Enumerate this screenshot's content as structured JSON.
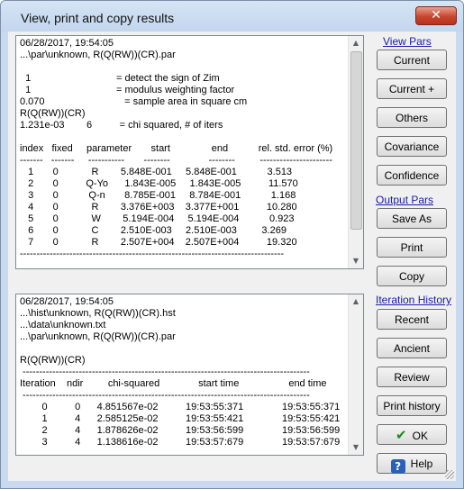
{
  "window": {
    "title": "View, print and copy results",
    "close_glyph": "✕"
  },
  "top_pane": {
    "lines": [
      "06/28/2017, 19:54:05",
      "...\\par\\unknown, R(Q(RW))(CR).par",
      "",
      "  1                               = detect the sign of Zim",
      "  1                               = modulus weighting factor",
      "0.070                             = sample area in square cm",
      "R(Q(RW))(CR)",
      "1.231e-03        6          = chi squared, # of iters",
      "",
      "index   fixed     parameter       start               end           rel. std. error (%)",
      "-------   -------     -----------       --------              --------         ----------------------",
      "   1       0            R        5.848E-001     5.848E-001           3.513",
      "   2       0          Q-Yo      1.843E-005     1.843E-005          11.570",
      "   3       0           Q-n       8.785E-001     8.784E-001           1.168",
      "   4       0            R        3.376E+003    3.377E+001          10.280",
      "   5       0            W        5.194E-004     5.194E-004           0.923",
      "   6       0            C        2.510E-003     2.510E-003         3.269",
      "   7       0            R        2.507E+004    2.507E+004          19.320",
      "--------------------------------------------------------------------------------"
    ]
  },
  "bottom_pane": {
    "lines": [
      "06/28/2017, 19:54:05",
      "...\\hist\\unknown, R(Q(RW))(CR).hst",
      "...\\data\\unknown.txt",
      "...\\par\\unknown, R(Q(RW))(CR).par",
      "",
      "R(Q(RW))(CR)",
      " ---------------------------------------------------------------------------------------",
      "Iteration    ndir         chi-squared              start time                  end time",
      " ---------------------------------------------------------------------------------------",
      "        0          0      4.851567e-02          19:53:55:371              19:53:55:371",
      "        1          4      2.585125e-02          19:53:55:421              19:53:55:421",
      "        2          4      1.878626e-02          19:53:56:599              19:53:56:599",
      "        3          4      1.138616e-02          19:53:57:679              19:53:57:679"
    ]
  },
  "sidebar": {
    "view_pars": "View Pars",
    "current": "Current",
    "current_plus": "Current +",
    "others": "Others",
    "covariance": "Covariance",
    "confidence": "Confidence",
    "output_pars": "Output Pars",
    "save_as": "Save As",
    "print": "Print",
    "copy": "Copy",
    "iteration_history": "Iteration History",
    "recent": "Recent",
    "ancient": "Ancient",
    "review": "Review",
    "print_history": "Print history",
    "ok": "OK",
    "help": "Help"
  },
  "icons": {
    "ok": "check-icon",
    "help": "question-mark-icon",
    "close": "close-icon"
  },
  "colors": {
    "title_bg": "#c9daf0",
    "close_btn": "#c8452e",
    "link": "#1a1aa8",
    "ok_check": "#1c8a1c",
    "help_icon": "#2b5fb8"
  }
}
